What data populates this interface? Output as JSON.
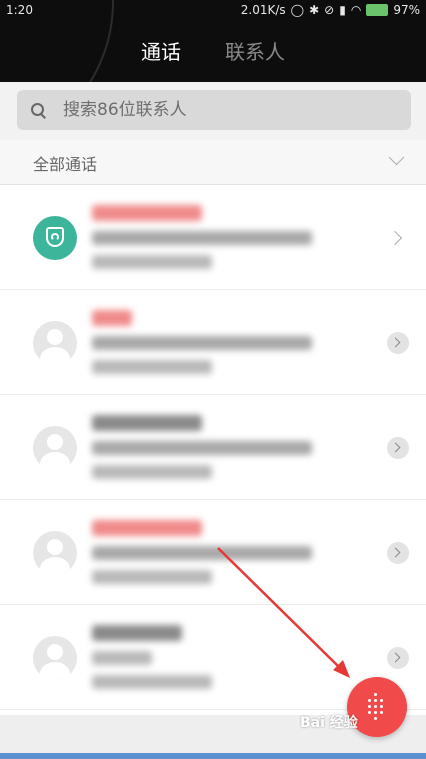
{
  "status_bar": {
    "time": "1:20",
    "speed": "2.01K/s",
    "battery": "97%"
  },
  "tabs": [
    {
      "label": "通话",
      "active": true
    },
    {
      "label": "联系人",
      "active": false
    }
  ],
  "search": {
    "placeholder": "搜索86位联系人"
  },
  "filter": {
    "label": "全部通话"
  },
  "colors": {
    "accent_green": "#3db59b",
    "fab_red": "#f04a4a",
    "annotation_red": "#e53935"
  },
  "watermark": "Bai 经验"
}
